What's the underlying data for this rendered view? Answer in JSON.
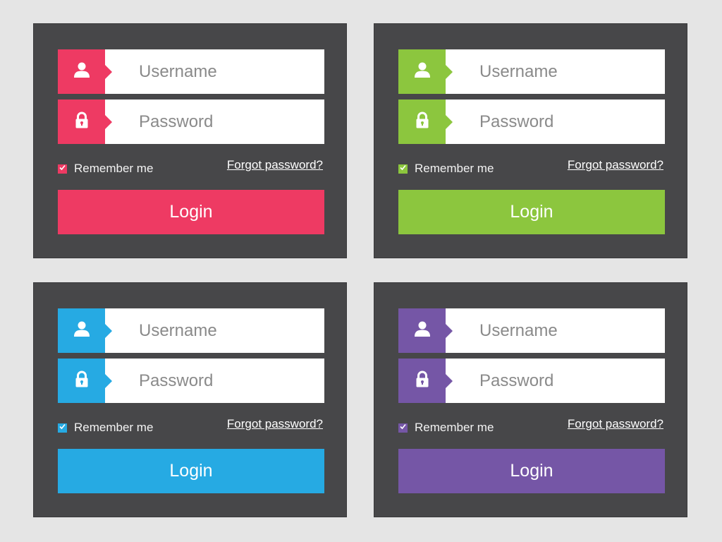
{
  "forms": [
    {
      "accent": "#ee3a63",
      "username_placeholder": "Username",
      "password_placeholder": "Password",
      "remember_label": "Remember me",
      "remember_checked": true,
      "forgot_label": "Forgot password?",
      "login_label": "Login",
      "user_icon": "user-icon",
      "lock_icon": "lock-icon"
    },
    {
      "accent": "#8cc63e",
      "username_placeholder": "Username",
      "password_placeholder": "Password",
      "remember_label": "Remember me",
      "remember_checked": true,
      "forgot_label": "Forgot password?",
      "login_label": "Login",
      "user_icon": "user-icon",
      "lock_icon": "lock-icon"
    },
    {
      "accent": "#26aae3",
      "username_placeholder": "Username",
      "password_placeholder": "Password",
      "remember_label": "Remember me",
      "remember_checked": true,
      "forgot_label": "Forgot password?",
      "login_label": "Login",
      "user_icon": "user-icon",
      "lock_icon": "lock-icon"
    },
    {
      "accent": "#7556a6",
      "username_placeholder": "Username",
      "password_placeholder": "Password",
      "remember_label": "Remember me",
      "remember_checked": true,
      "forgot_label": "Forgot password?",
      "login_label": "Login",
      "user_icon": "user-icon",
      "lock_icon": "lock-icon"
    }
  ],
  "colors": {
    "page_background": "#e5e5e5",
    "panel_background": "#474749",
    "field_background": "#ffffff",
    "placeholder_text": "#8a8a8a"
  }
}
